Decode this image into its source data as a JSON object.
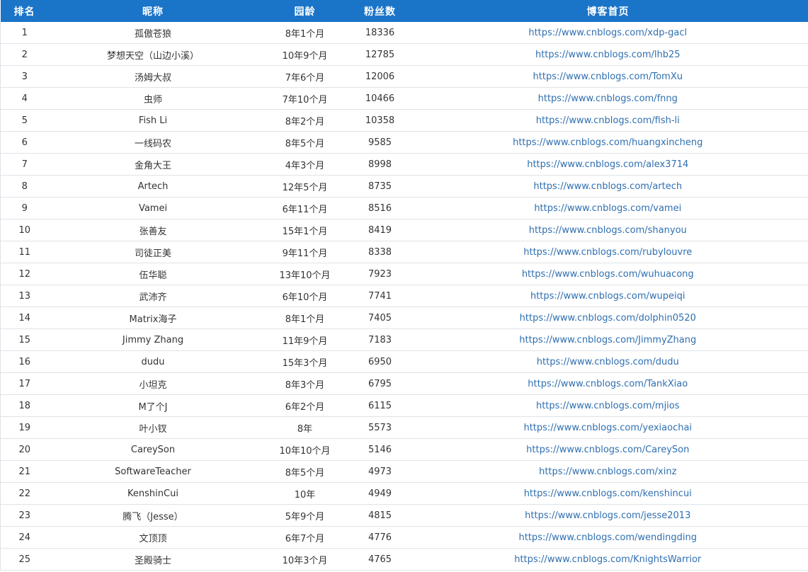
{
  "table": {
    "headers": {
      "rank": "排名",
      "name": "昵称",
      "age": "园龄",
      "fans": "粉丝数",
      "url": "博客首页"
    },
    "rows": [
      {
        "rank": "1",
        "name": "孤傲苍狼",
        "age": "8年1个月",
        "fans": "18336",
        "url": "https://www.cnblogs.com/xdp-gacl"
      },
      {
        "rank": "2",
        "name": "梦想天空（山边小溪）",
        "age": "10年9个月",
        "fans": "12785",
        "url": "https://www.cnblogs.com/lhb25"
      },
      {
        "rank": "3",
        "name": "汤姆大叔",
        "age": "7年6个月",
        "fans": "12006",
        "url": "https://www.cnblogs.com/TomXu"
      },
      {
        "rank": "4",
        "name": "虫师",
        "age": "7年10个月",
        "fans": "10466",
        "url": "https://www.cnblogs.com/fnng"
      },
      {
        "rank": "5",
        "name": "Fish Li",
        "age": "8年2个月",
        "fans": "10358",
        "url": "https://www.cnblogs.com/fish-li"
      },
      {
        "rank": "6",
        "name": "一线码农",
        "age": "8年5个月",
        "fans": "9585",
        "url": "https://www.cnblogs.com/huangxincheng"
      },
      {
        "rank": "7",
        "name": "金角大王",
        "age": "4年3个月",
        "fans": "8998",
        "url": "https://www.cnblogs.com/alex3714"
      },
      {
        "rank": "8",
        "name": "Artech",
        "age": "12年5个月",
        "fans": "8735",
        "url": "https://www.cnblogs.com/artech"
      },
      {
        "rank": "9",
        "name": "Vamei",
        "age": "6年11个月",
        "fans": "8516",
        "url": "https://www.cnblogs.com/vamei"
      },
      {
        "rank": "10",
        "name": "张善友",
        "age": "15年1个月",
        "fans": "8419",
        "url": "https://www.cnblogs.com/shanyou"
      },
      {
        "rank": "11",
        "name": "司徒正美",
        "age": "9年11个月",
        "fans": "8338",
        "url": "https://www.cnblogs.com/rubylouvre"
      },
      {
        "rank": "12",
        "name": "伍华聪",
        "age": "13年10个月",
        "fans": "7923",
        "url": "https://www.cnblogs.com/wuhuacong"
      },
      {
        "rank": "13",
        "name": "武沛齐",
        "age": "6年10个月",
        "fans": "7741",
        "url": "https://www.cnblogs.com/wupeiqi"
      },
      {
        "rank": "14",
        "name": "Matrix海子",
        "age": "8年1个月",
        "fans": "7405",
        "url": "https://www.cnblogs.com/dolphin0520"
      },
      {
        "rank": "15",
        "name": "Jimmy Zhang",
        "age": "11年9个月",
        "fans": "7183",
        "url": "https://www.cnblogs.com/JimmyZhang"
      },
      {
        "rank": "16",
        "name": "dudu",
        "age": "15年3个月",
        "fans": "6950",
        "url": "https://www.cnblogs.com/dudu"
      },
      {
        "rank": "17",
        "name": "小坦克",
        "age": "8年3个月",
        "fans": "6795",
        "url": "https://www.cnblogs.com/TankXiao"
      },
      {
        "rank": "18",
        "name": "M了个J",
        "age": "6年2个月",
        "fans": "6115",
        "url": "https://www.cnblogs.com/mjios"
      },
      {
        "rank": "19",
        "name": "叶小钗",
        "age": "8年",
        "fans": "5573",
        "url": "https://www.cnblogs.com/yexiaochai"
      },
      {
        "rank": "20",
        "name": "CareySon",
        "age": "10年10个月",
        "fans": "5146",
        "url": "https://www.cnblogs.com/CareySon"
      },
      {
        "rank": "21",
        "name": "SoftwareTeacher",
        "age": "8年5个月",
        "fans": "4973",
        "url": "https://www.cnblogs.com/xinz"
      },
      {
        "rank": "22",
        "name": "KenshinCui",
        "age": "10年",
        "fans": "4949",
        "url": "https://www.cnblogs.com/kenshincui"
      },
      {
        "rank": "23",
        "name": "腾飞（Jesse）",
        "age": "5年9个月",
        "fans": "4815",
        "url": "https://www.cnblogs.com/jesse2013"
      },
      {
        "rank": "24",
        "name": "文顶顶",
        "age": "6年7个月",
        "fans": "4776",
        "url": "https://www.cnblogs.com/wendingding"
      },
      {
        "rank": "25",
        "name": "圣殿骑士",
        "age": "10年3个月",
        "fans": "4765",
        "url": "https://www.cnblogs.com/KnightsWarrior"
      }
    ]
  }
}
